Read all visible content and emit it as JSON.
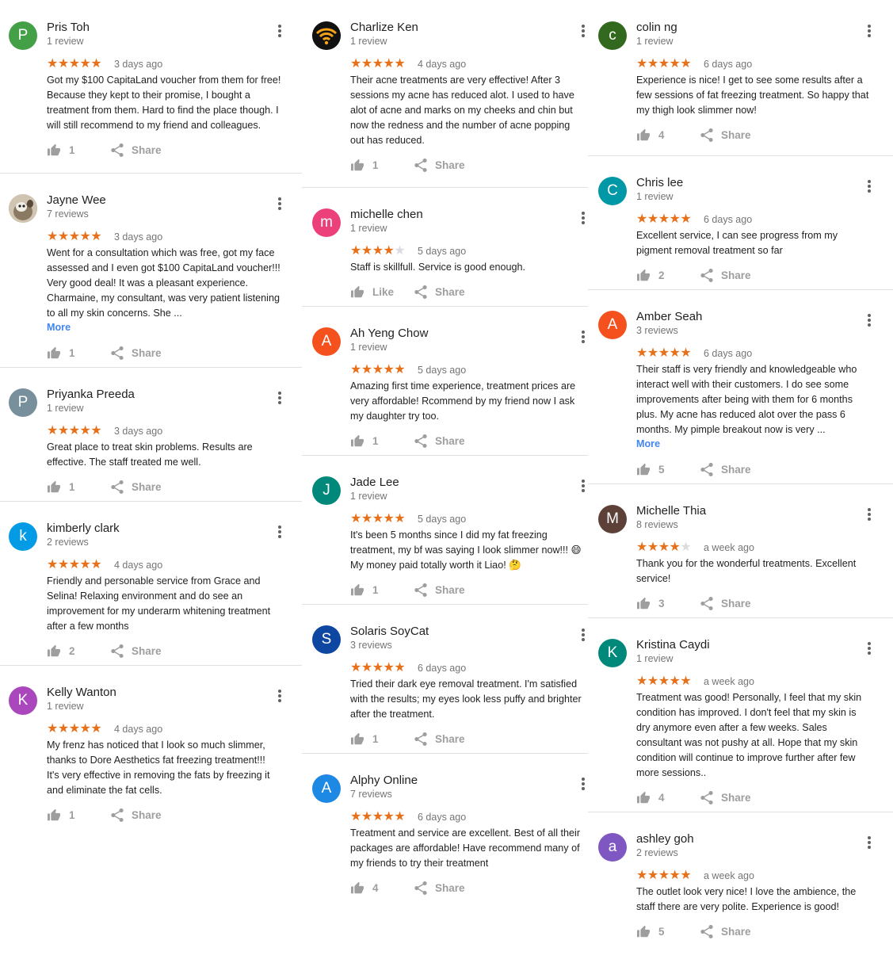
{
  "share_label": "Share",
  "more_label": "More",
  "reviews": [
    {
      "avatar": "P",
      "avatar_color": "#43a047",
      "name": "Pris Toh",
      "reviews": "1 review",
      "rating": 5,
      "date": "3 days ago",
      "text": "Got my $100 CapitaLand voucher from them for free!\nBecause they kept to their promise, I bought a\ntreatment from them. Hard to find the place though. I\nwill still recommend to my friend and colleagues.",
      "likes": "1"
    },
    {
      "avatar": "photo",
      "avatar_color": "#b0a48c",
      "name": "Jayne Wee",
      "reviews": "7 reviews",
      "rating": 5,
      "date": "3 days ago",
      "text": "Went for a consultation which was free, got my face\nassessed and I even got $100 CapitaLand voucher!!!\nVery good deal! It was a pleasant experience.\nCharmaine, my consultant, was very patient listening\nto all my skin concerns. She ...",
      "likes": "1",
      "more": true
    },
    {
      "avatar": "P",
      "avatar_color": "#78909c",
      "name": "Priyanka Preeda",
      "reviews": "1 review",
      "rating": 5,
      "date": "3 days ago",
      "text": "Great place to treat skin problems. Results are\neffective. The staff treated me well.",
      "likes": "1"
    },
    {
      "avatar": "k",
      "avatar_color": "#039be5",
      "name": "kimberly clark",
      "reviews": "2 reviews",
      "rating": 5,
      "date": "4 days ago",
      "text": "Friendly and personable service from Grace and\nSelina! Relaxing environment and do see an\nimprovement for my underarm whitening treatment\nafter a few months",
      "likes": "2"
    },
    {
      "avatar": "K",
      "avatar_color": "#ab47bc",
      "name": "Kelly Wanton",
      "reviews": "1 review",
      "rating": 5,
      "date": "4 days ago",
      "text": "My frenz has noticed that I look so much slimmer,\nthanks to Dore Aesthetics fat freezing treatment!!!\nIt's very effective in removing the fats by freezing it\nand eliminate the fat cells.",
      "likes": "1"
    },
    {
      "avatar": "wifi",
      "avatar_color": "#111111",
      "name": "Charlize Ken",
      "reviews": "1 review",
      "rating": 5,
      "date": "4 days ago",
      "text": "Their acne treatments are very effective! After 3\nsessions my acne has reduced alot. I used to have\nalot of acne and marks on my cheeks and chin but\nnow the redness and the number of acne popping\nout has reduced.",
      "likes": "1"
    },
    {
      "avatar": "m",
      "avatar_color": "#ec407a",
      "name": "michelle chen",
      "reviews": "1 review",
      "rating": 4,
      "date": "5 days ago",
      "text": "Staff is skillfull. Service is good enough.",
      "likes": "Like"
    },
    {
      "avatar": "A",
      "avatar_color": "#f4511e",
      "name": "Ah Yeng Chow",
      "reviews": "1 review",
      "rating": 5,
      "date": "5 days ago",
      "text": "Amazing first time experience, treatment prices are\nvery affordable! Rcommend by my friend now I ask\nmy daughter try too.",
      "likes": "1"
    },
    {
      "avatar": "J",
      "avatar_color": "#00897b",
      "name": "Jade Lee",
      "reviews": "1 review",
      "rating": 5,
      "date": "5 days ago",
      "text": "It's been 5 months since I did my fat freezing\ntreatment, my bf was saying I look slimmer now!!! 😄\nMy money paid totally worth it Liao! 🤔",
      "likes": "1"
    },
    {
      "avatar": "S",
      "avatar_color": "#0d47a1",
      "name": "Solaris SoyCat",
      "reviews": "3 reviews",
      "rating": 5,
      "date": "6 days ago",
      "text": "Tried their dark eye removal treatment. I'm satisfied\nwith the results; my eyes look less puffy and brighter\nafter the treatment.",
      "likes": "1"
    },
    {
      "avatar": "A",
      "avatar_color": "#1e88e5",
      "name": "Alphy Online",
      "reviews": "7 reviews",
      "rating": 5,
      "date": "6 days ago",
      "text": "Treatment and service are excellent. Best of all their\npackages are affordable! Have recommend many of\nmy friends to try their treatment",
      "likes": "4"
    },
    {
      "avatar": "c",
      "avatar_color": "#33691e",
      "name": "colin ng",
      "reviews": "1 review",
      "rating": 5,
      "date": "6 days ago",
      "text": "Experience is nice! I get to see some results after a\nfew sessions of fat freezing treatment. So happy that\nmy thigh look slimmer now!",
      "likes": "4"
    },
    {
      "avatar": "C",
      "avatar_color": "#0097a7",
      "name": "Chris lee",
      "reviews": "1 review",
      "rating": 5,
      "date": "6 days ago",
      "text": "Excellent service, I can see progress from my\npigment removal treatment so far",
      "likes": "2"
    },
    {
      "avatar": "A",
      "avatar_color": "#f4511e",
      "name": "Amber Seah",
      "reviews": "3 reviews",
      "rating": 5,
      "date": "6 days ago",
      "text": "Their staff is very friendly and knowledgeable who\ninteract well with their customers. I do see some\nimprovements after being with them for 6 months\nplus. My acne has reduced alot over the pass 6\nmonths. My pimple breakout now is very ...",
      "likes": "5",
      "more": true
    },
    {
      "avatar": "M",
      "avatar_color": "#5d4037",
      "name": "Michelle Thia",
      "reviews": "8 reviews",
      "rating": 4,
      "date": "a week ago",
      "text": "Thank you for the wonderful treatments. Excellent\nservice!",
      "likes": "3"
    },
    {
      "avatar": "K",
      "avatar_color": "#00897b",
      "name": "Kristina Caydi",
      "reviews": "1 review",
      "rating": 5,
      "date": "a week ago",
      "text": "Treatment was good! Personally, I feel that my skin\ncondition has improved. I don't feel that my skin is\ndry anymore even after a few weeks. Sales\nconsultant was not pushy at all. Hope that my skin\ncondition will continue to improve further after few\nmore sessions..",
      "likes": "4"
    },
    {
      "avatar": "a",
      "avatar_color": "#7e57c2",
      "name": "ashley goh",
      "reviews": "2 reviews",
      "rating": 5,
      "date": "a week ago",
      "text": "The outlet look very nice! I love the ambience, the\nstaff there are very polite. Experience is good!",
      "likes": "5"
    }
  ]
}
